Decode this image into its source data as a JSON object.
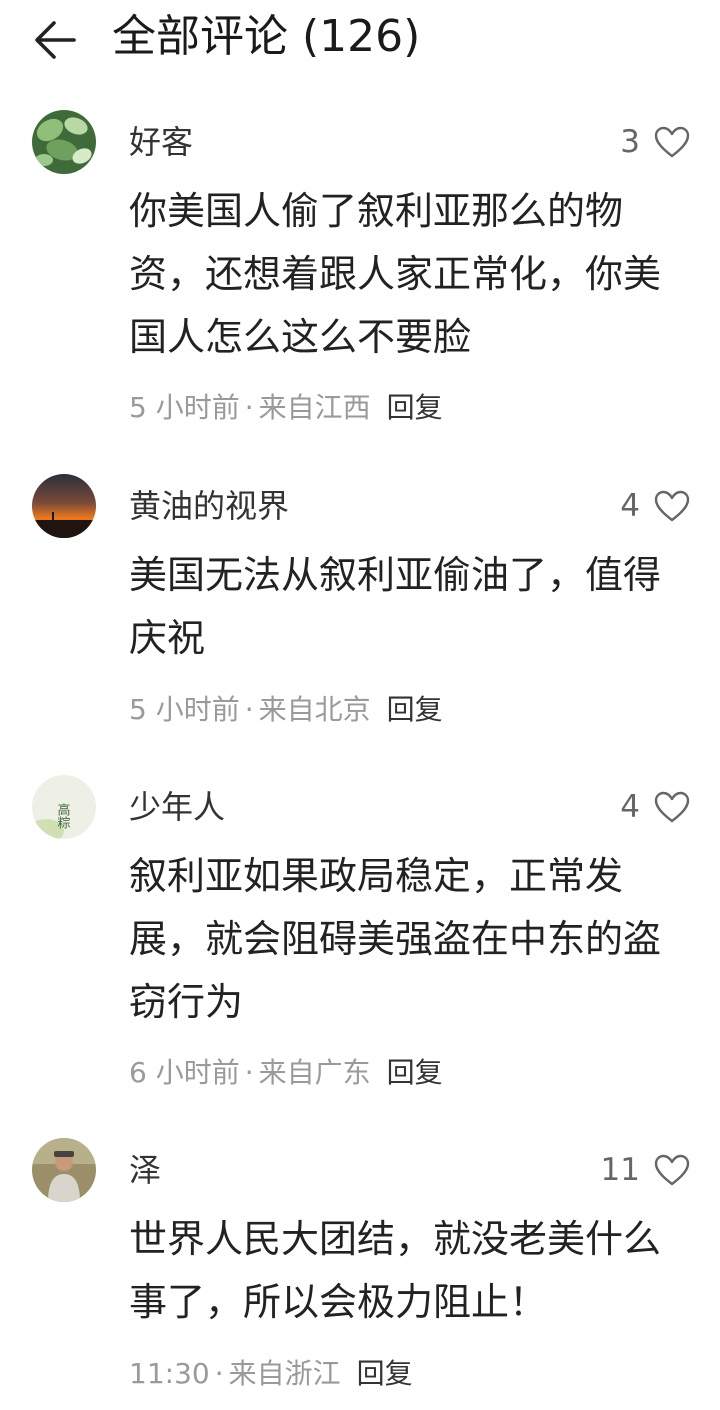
{
  "header": {
    "title": "全部评论 (126)"
  },
  "comments": [
    {
      "user": "好客",
      "likes": "3",
      "text": "你美国人偷了叙利亚那么的物资，还想着跟人家正常化，你美国人怎么这么不要脸",
      "time": "5 小时前",
      "location": "来自江西",
      "reply": "回复"
    },
    {
      "user": "黄油的视界",
      "likes": "4",
      "text": "美国无法从叙利亚偷油了，值得庆祝",
      "time": "5 小时前",
      "location": "来自北京",
      "reply": "回复"
    },
    {
      "user": "少年人",
      "likes": "4",
      "text": "叙利亚如果政局稳定，正常发展，就会阻碍美强盗在中东的盗窃行为",
      "time": "6 小时前",
      "location": "来自广东",
      "reply": "回复",
      "avatar_text": "高粽"
    },
    {
      "user": "泽",
      "likes": "11",
      "text": "世界人民大团结，就没老美什么事了，所以会极力阻止！",
      "time": "11:30",
      "location": "来自浙江",
      "reply": "回复"
    }
  ],
  "icons": {
    "back": "arrow-left-icon",
    "like": "heart-outline-icon"
  },
  "colors": {
    "text_primary": "#222222",
    "text_secondary": "#9a9a9a",
    "icon": "#666666"
  }
}
